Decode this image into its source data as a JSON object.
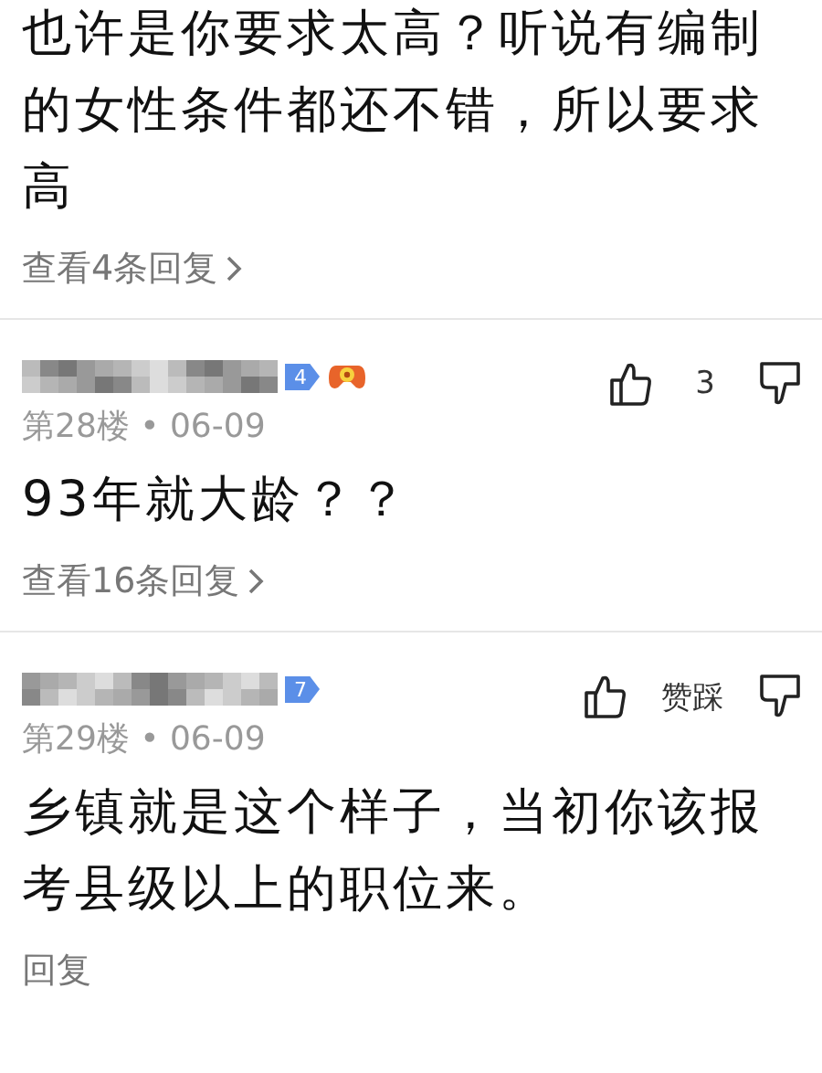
{
  "top_comment": {
    "text": "也许是你要求太高？听说有编制的女性条件都还不错，所以要求高",
    "reply_link": {
      "label": "查看4条回复",
      "chevron": true
    }
  },
  "comments": [
    {
      "badge": "4",
      "game_badge": true,
      "votes": "3",
      "meta": "第28楼 • 06-09",
      "text": "93年就大龄？？",
      "reply_link": {
        "label": "查看16条回复",
        "chevron": true
      }
    },
    {
      "badge": "7",
      "game_badge": false,
      "votes": "赞踩",
      "meta": "第29楼 • 06-09",
      "text": "乡镇就是这个样子，当初你该报考县级以上的职位来。",
      "reply_link": {
        "label": "回复",
        "chevron": false
      }
    }
  ]
}
